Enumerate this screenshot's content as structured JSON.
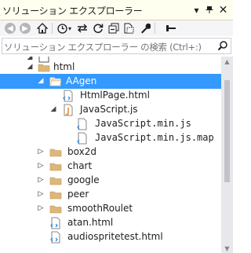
{
  "window": {
    "title": "ソリューション エクスプローラー"
  },
  "titlebar": {
    "dropdown_icon": "chevron-down-icon",
    "pin_icon": "pin-icon",
    "close_icon": "close-icon"
  },
  "toolbar": {
    "items": [
      {
        "name": "back-button",
        "icon": "back-arrow-icon",
        "enabled": false
      },
      {
        "name": "forward-button",
        "icon": "forward-arrow-icon",
        "enabled": false
      },
      {
        "name": "home-button",
        "icon": "home-icon",
        "enabled": true
      },
      {
        "name": "pending-changes-filter-button",
        "icon": "clock-icon",
        "enabled": true
      },
      {
        "name": "sync-with-active-document-button",
        "icon": "sync-icon",
        "enabled": true
      },
      {
        "name": "refresh-button",
        "icon": "refresh-icon",
        "enabled": true
      },
      {
        "name": "collapse-all-button",
        "icon": "collapse-all-icon",
        "enabled": true
      },
      {
        "name": "show-all-files-button",
        "icon": "show-all-files-icon",
        "enabled": true
      },
      {
        "name": "properties-button",
        "icon": "wrench-icon",
        "enabled": true
      },
      {
        "name": "preview-selected-button",
        "icon": "preview-icon",
        "enabled": true,
        "active": true
      }
    ]
  },
  "search": {
    "placeholder": "ソリューション エクスプローラー の検索 (Ctrl+:)"
  },
  "tree": {
    "rows": [
      {
        "label": "",
        "type": "project",
        "expanded": true,
        "partial": true
      },
      {
        "label": "html",
        "type": "folder",
        "expanded": true
      },
      {
        "label": "AAgen",
        "type": "folder",
        "expanded": true,
        "selected": true
      },
      {
        "label": "HtmlPage.html",
        "type": "html-file"
      },
      {
        "label": "JavaScript.js",
        "type": "js-file",
        "expanded": true
      },
      {
        "label": "JavaScript.min.js",
        "type": "js-file"
      },
      {
        "label": "JavaScript.min.js.map",
        "type": "js-file"
      },
      {
        "label": "box2d",
        "type": "folder",
        "expanded": false
      },
      {
        "label": "chart",
        "type": "folder",
        "expanded": false
      },
      {
        "label": "google",
        "type": "folder",
        "expanded": false
      },
      {
        "label": "peer",
        "type": "folder",
        "expanded": false
      },
      {
        "label": "smoothRoulet",
        "type": "folder",
        "expanded": false
      },
      {
        "label": "atan.html",
        "type": "html-file"
      },
      {
        "label": "audiospritetest.html",
        "type": "html-file"
      }
    ]
  },
  "colors": {
    "title_bg": "#fffff0",
    "toolbar_bg": "#f5f5f7",
    "selection": "#3399ff",
    "folder": "#dcb67a",
    "js_accent": "#f08a24",
    "html_accent": "#2b7bd3"
  }
}
